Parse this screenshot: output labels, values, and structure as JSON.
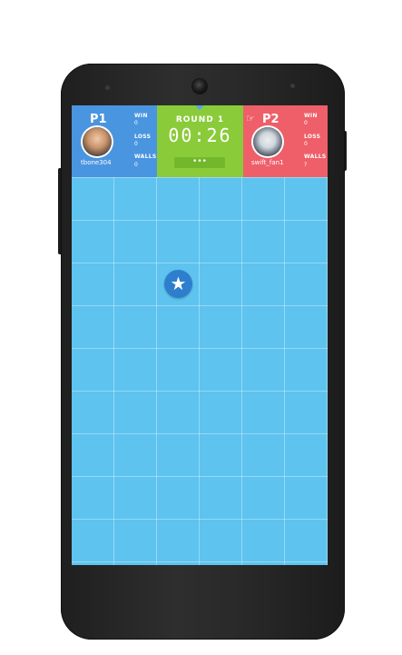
{
  "player1": {
    "tag": "P1",
    "name": "tbone304",
    "stats": [
      {
        "label": "WIN",
        "value": "0"
      },
      {
        "label": "LOSS",
        "value": "0"
      },
      {
        "label": "WALLS",
        "value": "0"
      }
    ]
  },
  "round": {
    "label": "ROUND 1",
    "timer": "00:26",
    "menu_label": "•••"
  },
  "player2": {
    "tag": "P2",
    "name": "swift_fan1",
    "stats": [
      {
        "label": "WIN",
        "value": "0"
      },
      {
        "label": "LOSS",
        "value": "0"
      },
      {
        "label": "WALLS",
        "value": "?"
      }
    ]
  },
  "board": {
    "pawn_symbol": "★"
  },
  "colors": {
    "p1_panel": "#4a95e0",
    "round_panel": "#8acb3a",
    "p2_panel": "#ef5f69",
    "board": "#5ec3ee",
    "pawn": "#2d7fcd"
  },
  "icons": {
    "turn_indicator": "pointing-hand-icon",
    "pawn": "star-icon"
  }
}
